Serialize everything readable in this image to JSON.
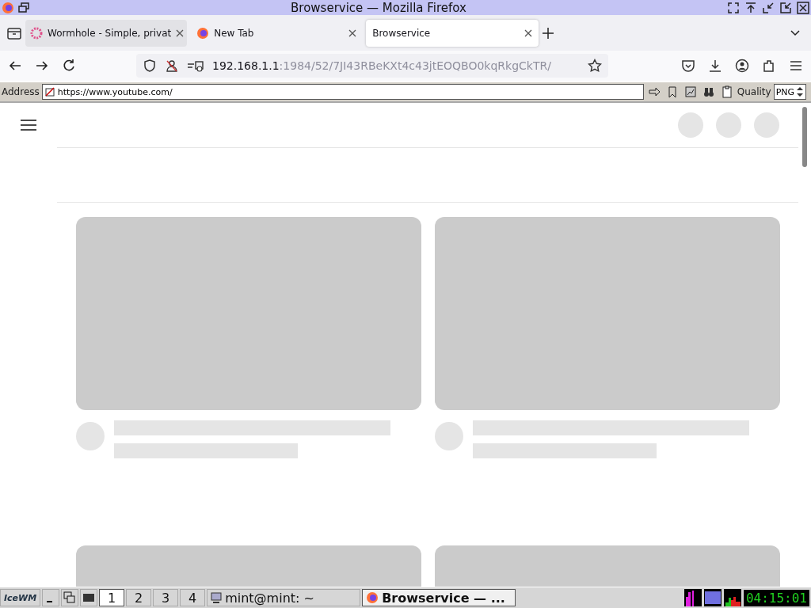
{
  "window": {
    "title": "Browservice — Mozilla Firefox"
  },
  "tabs": [
    {
      "label": "Wormhole - Simple, privat",
      "kind": "wormhole",
      "selected": false
    },
    {
      "label": "New Tab",
      "kind": "firefox",
      "selected": false
    },
    {
      "label": "Browservice",
      "kind": "plain",
      "selected": true
    }
  ],
  "url_bar": {
    "host": "192.168.1.1",
    "path": ":1984/52/7JI43RBeKXt4c43jtEOQBO0kqRkgCkTR/"
  },
  "browservice_toolbar": {
    "address_label": "Address",
    "address_value": "https://www.youtube.com/",
    "quality_label": "Quality",
    "quality_value": "PNG"
  },
  "content": {
    "kind": "skeleton"
  },
  "taskbar": {
    "logo": "IceWM",
    "workspaces": [
      {
        "label": "1",
        "selected": true
      },
      {
        "label": "2",
        "selected": false
      },
      {
        "label": "3",
        "selected": false
      },
      {
        "label": "4",
        "selected": false
      }
    ],
    "tasks": [
      {
        "label": "mint@mint: ~",
        "kind": "terminal",
        "selected": false
      },
      {
        "label": "Browservice — ...",
        "kind": "firefox",
        "selected": true
      }
    ],
    "clock": "04:15:01"
  }
}
